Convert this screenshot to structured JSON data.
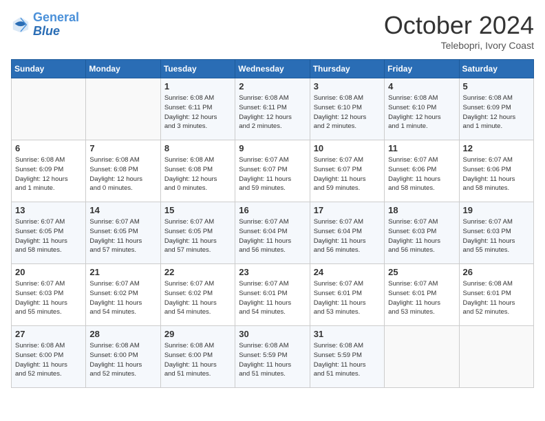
{
  "header": {
    "logo_line1": "General",
    "logo_line2": "Blue",
    "month": "October 2024",
    "location": "Telebopri, Ivory Coast"
  },
  "days_of_week": [
    "Sunday",
    "Monday",
    "Tuesday",
    "Wednesday",
    "Thursday",
    "Friday",
    "Saturday"
  ],
  "weeks": [
    [
      {
        "day": "",
        "info": ""
      },
      {
        "day": "",
        "info": ""
      },
      {
        "day": "1",
        "info": "Sunrise: 6:08 AM\nSunset: 6:11 PM\nDaylight: 12 hours\nand 3 minutes."
      },
      {
        "day": "2",
        "info": "Sunrise: 6:08 AM\nSunset: 6:11 PM\nDaylight: 12 hours\nand 2 minutes."
      },
      {
        "day": "3",
        "info": "Sunrise: 6:08 AM\nSunset: 6:10 PM\nDaylight: 12 hours\nand 2 minutes."
      },
      {
        "day": "4",
        "info": "Sunrise: 6:08 AM\nSunset: 6:10 PM\nDaylight: 12 hours\nand 1 minute."
      },
      {
        "day": "5",
        "info": "Sunrise: 6:08 AM\nSunset: 6:09 PM\nDaylight: 12 hours\nand 1 minute."
      }
    ],
    [
      {
        "day": "6",
        "info": "Sunrise: 6:08 AM\nSunset: 6:09 PM\nDaylight: 12 hours\nand 1 minute."
      },
      {
        "day": "7",
        "info": "Sunrise: 6:08 AM\nSunset: 6:08 PM\nDaylight: 12 hours\nand 0 minutes."
      },
      {
        "day": "8",
        "info": "Sunrise: 6:08 AM\nSunset: 6:08 PM\nDaylight: 12 hours\nand 0 minutes."
      },
      {
        "day": "9",
        "info": "Sunrise: 6:07 AM\nSunset: 6:07 PM\nDaylight: 11 hours\nand 59 minutes."
      },
      {
        "day": "10",
        "info": "Sunrise: 6:07 AM\nSunset: 6:07 PM\nDaylight: 11 hours\nand 59 minutes."
      },
      {
        "day": "11",
        "info": "Sunrise: 6:07 AM\nSunset: 6:06 PM\nDaylight: 11 hours\nand 58 minutes."
      },
      {
        "day": "12",
        "info": "Sunrise: 6:07 AM\nSunset: 6:06 PM\nDaylight: 11 hours\nand 58 minutes."
      }
    ],
    [
      {
        "day": "13",
        "info": "Sunrise: 6:07 AM\nSunset: 6:05 PM\nDaylight: 11 hours\nand 58 minutes."
      },
      {
        "day": "14",
        "info": "Sunrise: 6:07 AM\nSunset: 6:05 PM\nDaylight: 11 hours\nand 57 minutes."
      },
      {
        "day": "15",
        "info": "Sunrise: 6:07 AM\nSunset: 6:05 PM\nDaylight: 11 hours\nand 57 minutes."
      },
      {
        "day": "16",
        "info": "Sunrise: 6:07 AM\nSunset: 6:04 PM\nDaylight: 11 hours\nand 56 minutes."
      },
      {
        "day": "17",
        "info": "Sunrise: 6:07 AM\nSunset: 6:04 PM\nDaylight: 11 hours\nand 56 minutes."
      },
      {
        "day": "18",
        "info": "Sunrise: 6:07 AM\nSunset: 6:03 PM\nDaylight: 11 hours\nand 56 minutes."
      },
      {
        "day": "19",
        "info": "Sunrise: 6:07 AM\nSunset: 6:03 PM\nDaylight: 11 hours\nand 55 minutes."
      }
    ],
    [
      {
        "day": "20",
        "info": "Sunrise: 6:07 AM\nSunset: 6:03 PM\nDaylight: 11 hours\nand 55 minutes."
      },
      {
        "day": "21",
        "info": "Sunrise: 6:07 AM\nSunset: 6:02 PM\nDaylight: 11 hours\nand 54 minutes."
      },
      {
        "day": "22",
        "info": "Sunrise: 6:07 AM\nSunset: 6:02 PM\nDaylight: 11 hours\nand 54 minutes."
      },
      {
        "day": "23",
        "info": "Sunrise: 6:07 AM\nSunset: 6:01 PM\nDaylight: 11 hours\nand 54 minutes."
      },
      {
        "day": "24",
        "info": "Sunrise: 6:07 AM\nSunset: 6:01 PM\nDaylight: 11 hours\nand 53 minutes."
      },
      {
        "day": "25",
        "info": "Sunrise: 6:07 AM\nSunset: 6:01 PM\nDaylight: 11 hours\nand 53 minutes."
      },
      {
        "day": "26",
        "info": "Sunrise: 6:08 AM\nSunset: 6:01 PM\nDaylight: 11 hours\nand 52 minutes."
      }
    ],
    [
      {
        "day": "27",
        "info": "Sunrise: 6:08 AM\nSunset: 6:00 PM\nDaylight: 11 hours\nand 52 minutes."
      },
      {
        "day": "28",
        "info": "Sunrise: 6:08 AM\nSunset: 6:00 PM\nDaylight: 11 hours\nand 52 minutes."
      },
      {
        "day": "29",
        "info": "Sunrise: 6:08 AM\nSunset: 6:00 PM\nDaylight: 11 hours\nand 51 minutes."
      },
      {
        "day": "30",
        "info": "Sunrise: 6:08 AM\nSunset: 5:59 PM\nDaylight: 11 hours\nand 51 minutes."
      },
      {
        "day": "31",
        "info": "Sunrise: 6:08 AM\nSunset: 5:59 PM\nDaylight: 11 hours\nand 51 minutes."
      },
      {
        "day": "",
        "info": ""
      },
      {
        "day": "",
        "info": ""
      }
    ]
  ]
}
